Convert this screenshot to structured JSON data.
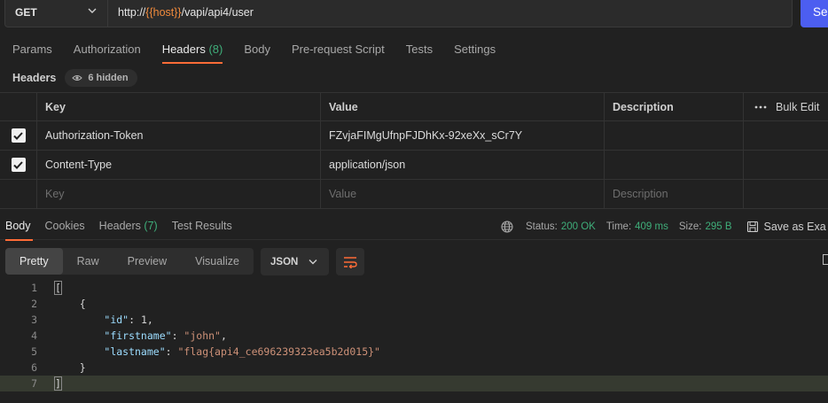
{
  "request": {
    "method": "GET",
    "url_prefix": "http://",
    "url_var": "{{host}}",
    "url_suffix": "/vapi/api4/user",
    "send_label": "Se"
  },
  "request_tabs": [
    {
      "label": "Params",
      "count": ""
    },
    {
      "label": "Authorization",
      "count": ""
    },
    {
      "label": "Headers",
      "count": "(8)"
    },
    {
      "label": "Body",
      "count": ""
    },
    {
      "label": "Pre-request Script",
      "count": ""
    },
    {
      "label": "Tests",
      "count": ""
    },
    {
      "label": "Settings",
      "count": ""
    }
  ],
  "headers_section": {
    "title": "Headers",
    "hidden_label": "6 hidden",
    "columns": {
      "key": "Key",
      "value": "Value",
      "description": "Description",
      "bulk_edit": "Bulk Edit"
    },
    "rows": [
      {
        "key": "Authorization-Token",
        "value": "FZvjaFIMgUfnpFJDhKx-92xeXx_sCr7Y",
        "description": ""
      },
      {
        "key": "Content-Type",
        "value": "application/json",
        "description": ""
      }
    ],
    "placeholder": {
      "key": "Key",
      "value": "Value",
      "description": "Description"
    }
  },
  "response_tabs": [
    {
      "label": "Body",
      "count": ""
    },
    {
      "label": "Cookies",
      "count": ""
    },
    {
      "label": "Headers",
      "count": "(7)"
    },
    {
      "label": "Test Results",
      "count": ""
    }
  ],
  "response_meta": {
    "status_label": "Status:",
    "status_value": "200 OK",
    "time_label": "Time:",
    "time_value": "409 ms",
    "size_label": "Size:",
    "size_value": "295 B",
    "save_label": "Save as Exa"
  },
  "view_modes": [
    "Pretty",
    "Raw",
    "Preview",
    "Visualize"
  ],
  "format": "JSON",
  "code_lines": [
    {
      "n": "1",
      "text": "["
    },
    {
      "n": "2",
      "text": "    {"
    },
    {
      "n": "3",
      "key": "\"id\"",
      "sep": ": ",
      "val": "1",
      "type": "n",
      "tail": ","
    },
    {
      "n": "4",
      "key": "\"firstname\"",
      "sep": ": ",
      "val": "\"john\"",
      "type": "s",
      "tail": ","
    },
    {
      "n": "5",
      "key": "\"lastname\"",
      "sep": ": ",
      "val": "\"flag{api4_ce696239323ea5b2d015}\"",
      "type": "s",
      "tail": ""
    },
    {
      "n": "6",
      "text": "    }"
    },
    {
      "n": "7",
      "text": "]"
    }
  ],
  "colors": {
    "accent": "#ff6c37",
    "send": "#4c5ef0",
    "success": "#3fae7a",
    "variable": "#f08a3c"
  }
}
